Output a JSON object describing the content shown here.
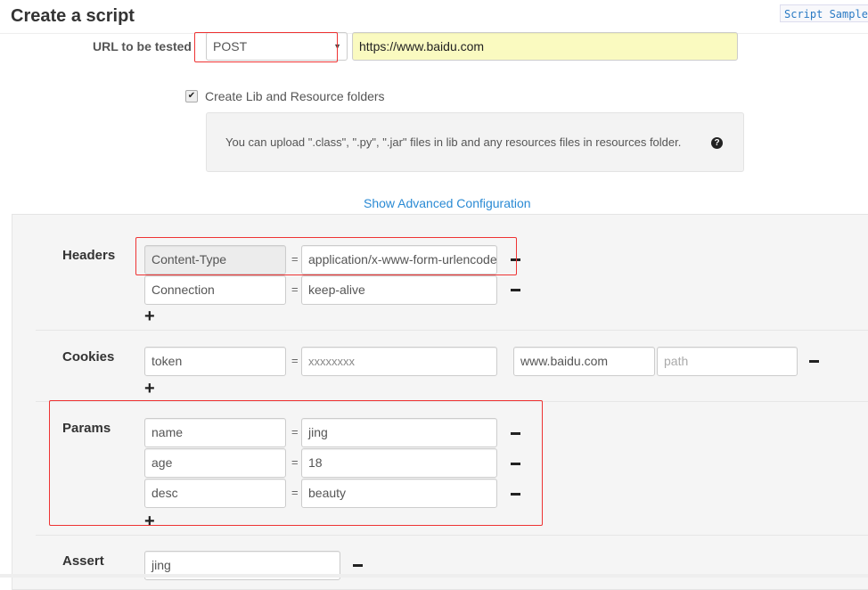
{
  "title": "Create a script",
  "script_sample": "Script Sample",
  "url_label": "URL to be tested",
  "method": "POST",
  "url": "https://www.baidu.com",
  "create_folders": {
    "label": "Create Lib and Resource folders",
    "checked": true
  },
  "info": "You can upload \".class\", \".py\", \".jar\" files in lib and any resources files in resources folder.",
  "advanced_link": "Show Advanced Configuration",
  "headers": {
    "label": "Headers",
    "rows": [
      {
        "key": "Content-Type",
        "value": "application/x-www-form-urlencoded"
      },
      {
        "key": "Connection",
        "value": "keep-alive"
      }
    ]
  },
  "cookies": {
    "label": "Cookies",
    "rows": [
      {
        "key": "token",
        "value": "xxxxxxxx",
        "domain": "www.baidu.com",
        "path_placeholder": "path"
      }
    ]
  },
  "params": {
    "label": "Params",
    "rows": [
      {
        "key": "name",
        "value": "jing"
      },
      {
        "key": "age",
        "value": "18"
      },
      {
        "key": "desc",
        "value": "beauty"
      }
    ]
  },
  "assert": {
    "label": "Assert",
    "rows": [
      {
        "value": "jing"
      }
    ]
  },
  "eq": "=",
  "colors": {
    "highlight": "#e33333",
    "link": "#2a8ad4",
    "url_bg": "#fafac0"
  }
}
